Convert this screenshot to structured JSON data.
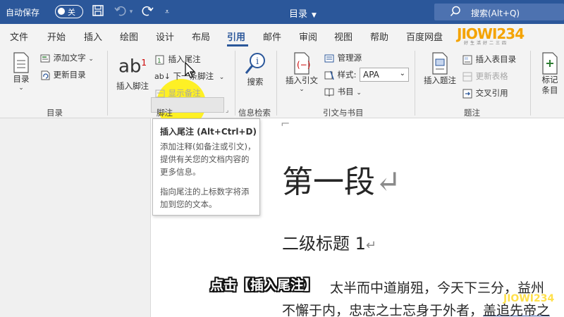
{
  "titlebar": {
    "autosave_label": "自动保存",
    "autosave_state": "关",
    "doc_title": "目录",
    "search_placeholder": "搜索(Alt+Q)"
  },
  "tabs": [
    {
      "label": "文件"
    },
    {
      "label": "开始"
    },
    {
      "label": "插入"
    },
    {
      "label": "绘图"
    },
    {
      "label": "设计"
    },
    {
      "label": "布局"
    },
    {
      "label": "引用"
    },
    {
      "label": "邮件"
    },
    {
      "label": "审阅"
    },
    {
      "label": "视图"
    },
    {
      "label": "帮助"
    },
    {
      "label": "百度网盘"
    }
  ],
  "logo": {
    "text": "JIOWI234",
    "sub": "好生活好二三四"
  },
  "ribbon": {
    "toc": {
      "toc_button": "目录",
      "add_text": "添加文字",
      "update_toc": "更新目录",
      "group": "目录"
    },
    "footnotes": {
      "insert_footnote": "插入脚注",
      "insert_endnote": "插入尾注",
      "next_footnote": "下一条脚注",
      "show_notes": "显示备注",
      "group": "脚注",
      "ab_glyph": "ab",
      "sup": "1"
    },
    "research": {
      "search": "搜索",
      "group": "信息检索"
    },
    "citations": {
      "insert_citation": "插入引文",
      "manage_sources": "管理源",
      "style_label": "样式:",
      "style_value": "APA",
      "bibliography": "书目",
      "group": "引文与书目"
    },
    "captions": {
      "insert_caption": "插入题注",
      "insert_table_of_figures": "插入表目录",
      "update_table": "更新表格",
      "cross_reference": "交叉引用",
      "group": "题注"
    },
    "index": {
      "mark_entry": "标记条目"
    }
  },
  "tooltip": {
    "title": "插入尾注 (Alt+Ctrl+D)",
    "para1": "添加注释(如备注或引文)，提供有关您的文档内容的更多信息。",
    "para2": "指向尾注的上标数字将添加到您的文本。"
  },
  "document": {
    "heading1": "第一段",
    "heading2": "二级标题 1",
    "line1_a": "太半而中道崩殂，今天下三分，益州",
    "line2_a": "不懈于内，忠志之士忘身于外者，",
    "line2_b": "盖追先帝之",
    "para_mark": "↵"
  },
  "caption": "点击【插入尾注】",
  "colors": {
    "word_blue": "#2b579a",
    "ribbon_bg": "#f3f3f3",
    "highlight": "#ffef00"
  }
}
